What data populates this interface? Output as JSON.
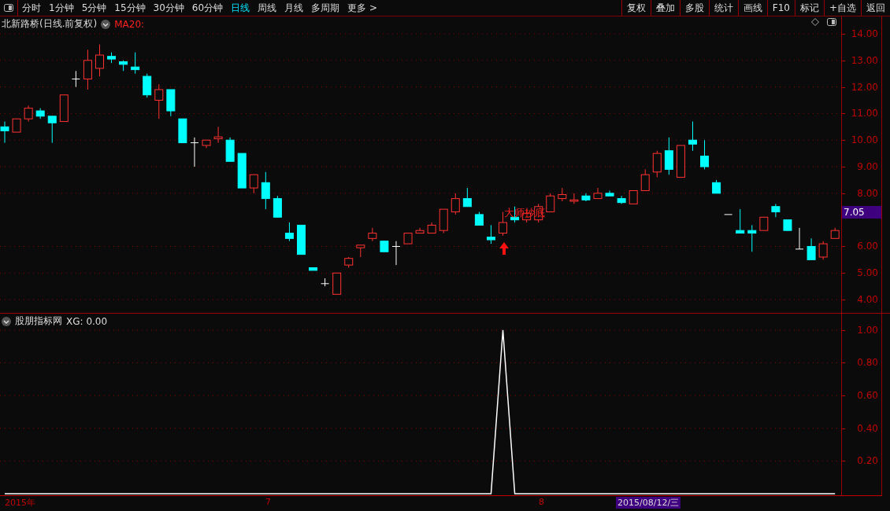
{
  "toolbar": {
    "periods": [
      {
        "label": "分时",
        "selected": false
      },
      {
        "label": "1分钟",
        "selected": false
      },
      {
        "label": "5分钟",
        "selected": false
      },
      {
        "label": "15分钟",
        "selected": false
      },
      {
        "label": "30分钟",
        "selected": false
      },
      {
        "label": "60分钟",
        "selected": false
      },
      {
        "label": "日线",
        "selected": true
      },
      {
        "label": "周线",
        "selected": false
      },
      {
        "label": "月线",
        "selected": false
      },
      {
        "label": "多周期",
        "selected": false
      },
      {
        "label": "更多 >",
        "selected": false
      }
    ],
    "actions": [
      "复权",
      "叠加",
      "多股",
      "统计",
      "画线",
      "F10",
      "标记",
      "+自选",
      "返回"
    ]
  },
  "price_panel": {
    "title": "北新路桥(日线.前复权)",
    "indicator": "MA20:",
    "current_price": "7.05",
    "signal_label": "大师抄底",
    "chart_data": {
      "type": "candlestick",
      "ylim": [
        3.5,
        14.65
      ],
      "yticks": [
        {
          "value": 14,
          "label": "14.00"
        },
        {
          "value": 13,
          "label": "13.00"
        },
        {
          "value": 12,
          "label": "12.00"
        },
        {
          "value": 11,
          "label": "11.00"
        },
        {
          "value": 10,
          "label": "10.00"
        },
        {
          "value": 9,
          "label": "9.00"
        },
        {
          "value": 8,
          "label": "8.00"
        },
        {
          "value": 6,
          "label": "6.00"
        },
        {
          "value": 5,
          "label": "5.00"
        },
        {
          "value": 4,
          "label": "4.00"
        }
      ],
      "grid": true,
      "ohlc": [
        [
          10.5,
          10.7,
          9.9,
          10.35
        ],
        [
          10.3,
          10.8,
          10.3,
          10.8
        ],
        [
          10.8,
          11.3,
          10.7,
          11.2
        ],
        [
          11.1,
          11.2,
          10.8,
          10.9
        ],
        [
          10.9,
          10.9,
          9.9,
          10.65
        ],
        [
          10.7,
          11.7,
          10.7,
          11.7
        ],
        [
          12.3,
          12.6,
          12.0,
          12.3
        ],
        [
          12.3,
          13.4,
          11.9,
          13.0
        ],
        [
          12.7,
          13.6,
          12.4,
          13.2
        ],
        [
          13.15,
          13.3,
          12.9,
          13.05
        ],
        [
          12.95,
          13.0,
          12.6,
          12.85
        ],
        [
          12.75,
          13.3,
          12.5,
          12.65
        ],
        [
          12.4,
          12.5,
          11.6,
          11.7
        ],
        [
          11.5,
          12.1,
          10.8,
          11.9
        ],
        [
          11.9,
          11.9,
          10.9,
          11.1
        ],
        [
          10.8,
          10.8,
          9.9,
          9.9
        ],
        [
          9.9,
          10.1,
          9.0,
          9.9
        ],
        [
          9.8,
          10.0,
          9.7,
          10.0
        ],
        [
          10.05,
          10.5,
          9.9,
          10.12
        ],
        [
          10.0,
          10.1,
          9.2,
          9.2
        ],
        [
          9.5,
          9.5,
          8.2,
          8.2
        ],
        [
          8.2,
          8.7,
          8.0,
          8.7
        ],
        [
          8.4,
          8.8,
          7.4,
          7.8
        ],
        [
          7.8,
          7.9,
          7.1,
          7.1
        ],
        [
          6.5,
          6.9,
          6.2,
          6.3
        ],
        [
          6.8,
          6.8,
          5.7,
          5.7
        ],
        [
          5.2,
          5.2,
          5.1,
          5.1
        ],
        [
          4.6,
          4.8,
          4.5,
          4.6
        ],
        [
          4.2,
          5.0,
          4.2,
          5.0
        ],
        [
          5.3,
          5.6,
          5.2,
          5.55
        ],
        [
          5.95,
          6.05,
          5.6,
          6.05
        ],
        [
          6.3,
          6.7,
          6.2,
          6.5
        ],
        [
          6.2,
          6.2,
          5.8,
          5.8
        ],
        [
          6.0,
          6.2,
          5.3,
          6.0
        ],
        [
          6.1,
          6.5,
          6.1,
          6.5
        ],
        [
          6.5,
          6.7,
          6.5,
          6.6
        ],
        [
          6.5,
          6.9,
          6.5,
          6.8
        ],
        [
          6.6,
          7.4,
          6.5,
          7.4
        ],
        [
          7.3,
          8.0,
          7.2,
          7.8
        ],
        [
          7.8,
          8.2,
          7.5,
          7.5
        ],
        [
          7.2,
          7.3,
          6.8,
          6.8
        ],
        [
          6.35,
          6.8,
          6.1,
          6.25
        ],
        [
          6.5,
          7.3,
          6.4,
          6.9
        ],
        [
          7.1,
          7.5,
          6.9,
          7.0
        ],
        [
          7.0,
          7.4,
          6.9,
          7.25
        ],
        [
          7.0,
          7.6,
          6.9,
          7.5
        ],
        [
          7.3,
          8.0,
          7.3,
          7.9
        ],
        [
          7.8,
          8.2,
          7.7,
          7.95
        ],
        [
          7.7,
          8.0,
          7.6,
          7.75
        ],
        [
          7.9,
          8.0,
          7.7,
          7.75
        ],
        [
          7.8,
          8.2,
          7.8,
          8.0
        ],
        [
          8.0,
          8.1,
          7.9,
          7.9
        ],
        [
          7.8,
          7.9,
          7.6,
          7.65
        ],
        [
          7.6,
          8.1,
          7.6,
          8.1
        ],
        [
          8.1,
          8.9,
          8.1,
          8.7
        ],
        [
          8.8,
          9.6,
          8.6,
          9.5
        ],
        [
          9.6,
          10.1,
          8.7,
          8.9
        ],
        [
          8.6,
          9.8,
          8.6,
          9.8
        ],
        [
          10.0,
          10.7,
          9.6,
          9.85
        ],
        [
          9.4,
          10.0,
          8.9,
          9.0
        ],
        [
          8.4,
          8.5,
          8.0,
          8.0
        ],
        [
          7.2,
          7.2,
          7.2,
          7.2
        ],
        [
          6.6,
          7.4,
          6.5,
          6.5
        ],
        [
          6.6,
          6.8,
          5.8,
          6.5
        ],
        [
          6.6,
          7.1,
          6.6,
          7.1
        ],
        [
          7.5,
          7.6,
          7.1,
          7.3
        ],
        [
          7.0,
          7.0,
          6.6,
          6.6
        ],
        [
          5.9,
          6.7,
          5.9,
          5.9
        ],
        [
          6.0,
          6.3,
          5.5,
          5.5
        ],
        [
          5.6,
          6.2,
          5.5,
          6.1
        ],
        [
          6.3,
          6.7,
          6.3,
          6.6
        ]
      ]
    }
  },
  "indicator_panel": {
    "title": "股朋指标网",
    "readout": ": 0.00",
    "chart_data": {
      "type": "line",
      "grid": true,
      "ylim": [
        0,
        1.1
      ],
      "yticks": [
        {
          "value": 1,
          "label": "1.00"
        },
        {
          "value": 0.8,
          "label": "0.80"
        },
        {
          "value": 0.6,
          "label": "0.60"
        },
        {
          "value": 0.4,
          "label": "0.40"
        },
        {
          "value": 0.2,
          "label": "0.20"
        }
      ],
      "series": [
        {
          "name": "XG",
          "color": "#ffffff",
          "values": [
            0,
            0,
            0,
            0,
            0,
            0,
            0,
            0,
            0,
            0,
            0,
            0,
            0,
            0,
            0,
            0,
            0,
            0,
            0,
            0,
            0,
            0,
            0,
            0,
            0,
            0,
            0,
            0,
            0,
            0,
            0,
            0,
            0,
            0,
            0,
            0,
            0,
            0,
            0,
            0,
            0,
            0,
            1,
            0,
            0,
            0,
            0,
            0,
            0,
            0,
            0,
            0,
            0,
            0,
            0,
            0,
            0,
            0,
            0,
            0,
            0,
            0,
            0,
            0,
            0,
            0,
            0,
            0,
            0,
            0,
            0
          ]
        }
      ]
    }
  },
  "time_axis": {
    "labels": [
      "2015年",
      "7",
      "8"
    ],
    "cursor_date": "2015/08/12/三"
  }
}
